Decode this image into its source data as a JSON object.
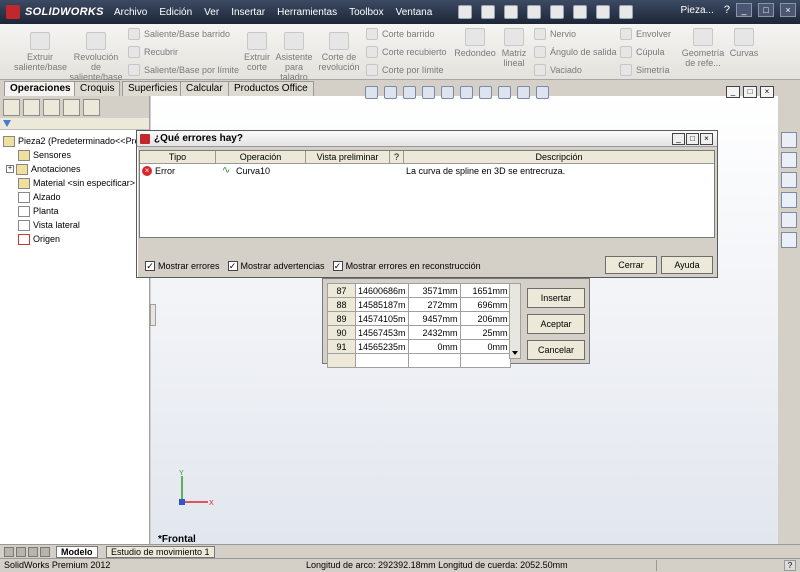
{
  "app": {
    "logo_text": "SOLIDWORKS",
    "menu": [
      "Archivo",
      "Edición",
      "Ver",
      "Insertar",
      "Herramientas",
      "Toolbox",
      "Ventana"
    ],
    "document_title": "Pieza...",
    "help_icon": "?"
  },
  "ribbon": {
    "extruir_saliente": "Extruir saliente/base",
    "revolucion_saliente": "Revolución de saliente/base",
    "saliente_barrido": "Saliente/Base barrido",
    "recubrir": "Recubrir",
    "saliente_limite": "Saliente/Base por límite",
    "extruir_corte": "Extruir corte",
    "asistente_taladro": "Asistente para taladro",
    "corte_revolucion": "Corte de revolución",
    "corte_barrido": "Corte barrido",
    "corte_recubierto": "Corte recubierto",
    "corte_limite": "Corte por límite",
    "redondeo": "Redondeo",
    "matriz_lineal": "Matriz lineal",
    "nervio": "Nervio",
    "angulo_salida": "Ángulo de salida",
    "vaciado": "Vaciado",
    "envolver": "Envolver",
    "cupula": "Cúpula",
    "simetria": "Simetría",
    "geometria_referencia": "Geometría de refe...",
    "curvas": "Curvas"
  },
  "tabs": [
    "Operaciones",
    "Croquis",
    "Superficies",
    "Calcular",
    "Productos Office"
  ],
  "tree": {
    "root": "Pieza2  (Predeterminado<<Pre",
    "items": [
      "Sensores",
      "Anotaciones",
      "Material <sin especificar>",
      "Alzado",
      "Planta",
      "Vista lateral",
      "Origen"
    ]
  },
  "view_controls": [
    "_",
    "□",
    "×"
  ],
  "graphics": {
    "view_name": "*Frontal",
    "axis_x": "X",
    "axis_y": "Y"
  },
  "points_table": {
    "rows": [
      {
        "idx": "87",
        "c1": "14600686m",
        "c2": "3571mm",
        "c3": "1651mm"
      },
      {
        "idx": "88",
        "c1": "14585187m",
        "c2": "272mm",
        "c3": "696mm"
      },
      {
        "idx": "89",
        "c1": "14574105m",
        "c2": "9457mm",
        "c3": "206mm"
      },
      {
        "idx": "90",
        "c1": "14567453m",
        "c2": "2432mm",
        "c3": "25mm"
      },
      {
        "idx": "91",
        "c1": "14565235m",
        "c2": "0mm",
        "c3": "0mm"
      }
    ],
    "insert_label": "Insertar",
    "accept_label": "Aceptar",
    "cancel_label": "Cancelar"
  },
  "error_dialog": {
    "title": "¿Qué errores hay?",
    "columns": {
      "tipo": "Tipo",
      "operacion": "Operación",
      "vista": "Vista preliminar",
      "q": "?",
      "descripcion": "Descripción"
    },
    "row": {
      "tipo": "Error",
      "operacion": "Curva10",
      "descripcion": "La curva de spline en 3D se entrecruza."
    },
    "checks": [
      {
        "label": "Mostrar errores",
        "checked": true
      },
      {
        "label": "Mostrar advertencias",
        "checked": true
      },
      {
        "label": "Mostrar errores en reconstrucción",
        "checked": true
      }
    ],
    "close_label": "Cerrar",
    "help_label": "Ayuda"
  },
  "bottom_tabs": [
    "Modelo",
    "Estudio de movimiento 1"
  ],
  "status": {
    "left": "SolidWorks Premium 2012",
    "middle": "Longitud de arco: 292392.18mm Longitud de cuerda: 2052.50mm",
    "help": "?"
  }
}
